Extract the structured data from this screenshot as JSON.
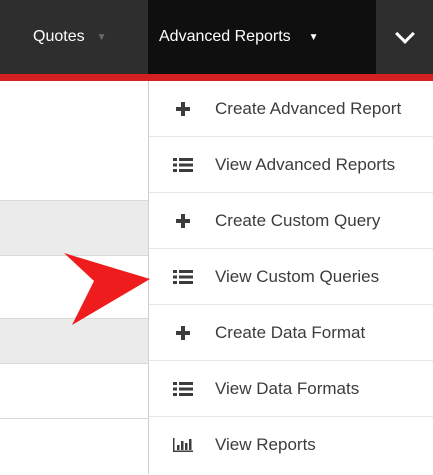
{
  "nav": {
    "quotes_label": "Quotes",
    "advanced_reports_label": "Advanced Reports",
    "accent_color": "#d42020"
  },
  "dropdown": {
    "items": [
      {
        "label": "Create Advanced Report",
        "icon": "plus-icon"
      },
      {
        "label": "View Advanced Reports",
        "icon": "list-icon"
      },
      {
        "label": "Create Custom Query",
        "icon": "plus-icon"
      },
      {
        "label": "View Custom Queries",
        "icon": "list-icon"
      },
      {
        "label": "Create Data Format",
        "icon": "plus-icon"
      },
      {
        "label": "View Data Formats",
        "icon": "list-icon"
      },
      {
        "label": "View Reports",
        "icon": "bar-chart-icon"
      }
    ]
  }
}
